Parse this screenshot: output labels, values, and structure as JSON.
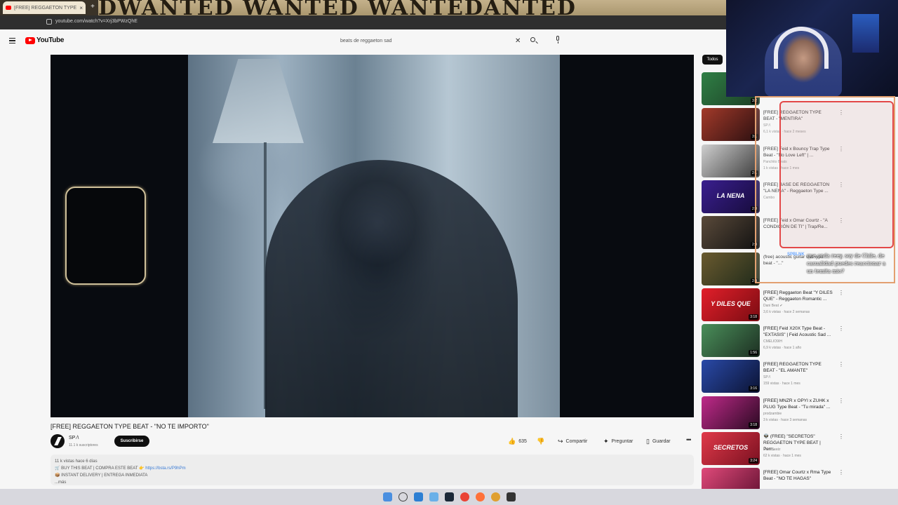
{
  "browser": {
    "tab_title": "[FREE] REGGAETON TYPE BEAT",
    "tab_close": "×",
    "new_tab": "+",
    "url": "youtube.com/watch?v=Xrj3bPWzQhE",
    "banner_art": "DWANTED WANTED WANTEDANTED"
  },
  "header": {
    "logo": "YouTube",
    "search_query": "beats de reggaeton sad",
    "clear": "✕"
  },
  "video": {
    "title": "[FREE] REGGAETON TYPE BEAT - \"NO TE IMPORTO\"",
    "channel": "SP ⁄\\",
    "subscribers": "11.1 k suscriptores",
    "subscribe": "Suscribirse",
    "likes": "635",
    "share": "Compartir",
    "ask": "Preguntar",
    "save": "Guardar",
    "more": "•••"
  },
  "description": {
    "views": "11 k vistas  hace 6 días",
    "line1": "🛒 BUY THIS BEAT | COMPRA ESTE BEAT 👉",
    "line1_link": "https://bsta.rs/P9hPm",
    "line2": "📦 INSTANT DELIVERY | ENTREGA INMEDIATA",
    "more": "...más"
  },
  "sidebar": {
    "chip": "Todos",
    "items": [
      {
        "title": "",
        "channel": "",
        "meta": "",
        "duration": "3:2",
        "thumb_text": "",
        "color1": "#2f7f45",
        "color2": "#1c3d25"
      },
      {
        "title": "[FREE] REGGAETON TYPE BEAT - \"MENTIRA\"",
        "channel": "SP ⁄\\",
        "meta": "6,1 k vistas · hace 2 meses",
        "duration": "3:1",
        "thumb_text": "",
        "color1": "#a33a2a",
        "color2": "#2a0f10"
      },
      {
        "title": "[FREE] Feid x Bouncy Trap Type Beat - \"No Love Left\" | ...",
        "channel": "Panchito Beats",
        "meta": "1 k vistas · hace 1 mes",
        "duration": "2:1",
        "thumb_text": "",
        "color1": "#cfcfcf",
        "color2": "#3a3a3a"
      },
      {
        "title": "[FREE] BASE DE REGGAETON \"LA NENA\" - Reggaeton Type ...",
        "channel": "Cambo",
        "meta": "",
        "duration": "2:0",
        "thumb_text": "LA NENA",
        "color1": "#3a1f8f",
        "color2": "#160b3a"
      },
      {
        "title": "[FREE] Feid x Omar Courtz - \"A CONDICIÓN DE TI\" | Trap/Re...",
        "channel": "",
        "meta": "",
        "duration": "2:3",
        "thumb_text": "",
        "color1": "#5a4a3a",
        "color2": "#111111"
      },
      {
        "title": "(free) acoustic guitar sad type beat - \"...\"",
        "channel": "",
        "meta": "",
        "duration": "2:4",
        "thumb_text": "",
        "color1": "#6a5a2f",
        "color2": "#1f2a1a"
      },
      {
        "title": "[FREE] Reggaeton Beat \"Y DILES QUE\" - Reggaeton Romantic ...",
        "channel": "Dani Beat ✔",
        "meta": "3,6 k vistas · hace 2 semanas",
        "duration": "3:18",
        "thumb_text": "Y DILES QUE",
        "color1": "#e21f2a",
        "color2": "#7a0c12"
      },
      {
        "title": "[FREE] Feid X20X Type Beat - \"EXTASIS\" | Feid Acoustic Sad ...",
        "channel": "CMELIO9IH",
        "meta": "6,9 k vistas · hace 1 año",
        "duration": "1:56",
        "thumb_text": "",
        "color1": "#4a8f5a",
        "color2": "#1d2f22"
      },
      {
        "title": "[FREE] REGGAETON TYPE BEAT - \"EL AMANTE\"",
        "channel": "SP ⁄\\",
        "meta": "159 vistas · hace 1 mes",
        "duration": "3:16",
        "thumb_text": "",
        "color1": "#2a4aa8",
        "color2": "#0b1333"
      },
      {
        "title": "[FREE] MNZR x OPYI x ZUHK x PLUG Type Beat - \"Tu mirada\" ...",
        "channel": "prodzambie",
        "meta": "3 k vistas · hace 3 semanas",
        "duration": "3:18",
        "thumb_text": "",
        "color1": "#c02a8a",
        "color2": "#2a0a22"
      },
      {
        "title": "👽 (FREE) \"SECRETOS\" REGGAETON TYPE BEAT | Perr...",
        "channel": "Dani Beatz",
        "meta": "62 k vistas · hace 1 mes",
        "duration": "3:24",
        "thumb_text": "SECRETOS",
        "color1": "#e03a4a",
        "color2": "#7a1020"
      },
      {
        "title": "[FREE] Omar Courtz x Rma Type Beat - \"NO TE HAGAS\"",
        "channel": "",
        "meta": "",
        "duration": "",
        "thumb_text": "",
        "color1": "#e04a7a",
        "color2": "#601030"
      }
    ]
  },
  "chat": {
    "username": "SPBLNK",
    "message": "que onda reey, soy de Chile, de casualidad puedes reaccionar a un temita mio?"
  },
  "colors": {
    "youtube_red": "#ff0000",
    "overlay_orange": "#e3a070",
    "overlay_red": "#e34848"
  }
}
